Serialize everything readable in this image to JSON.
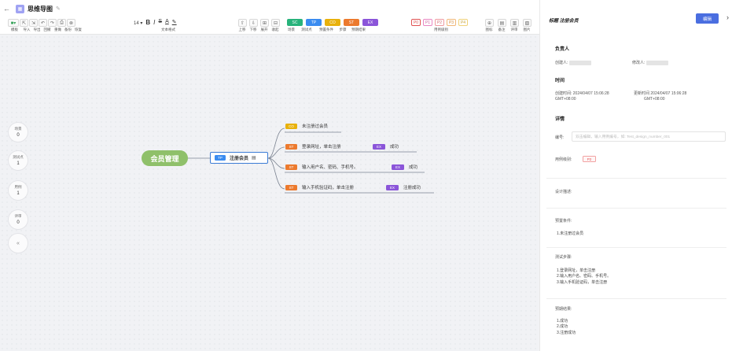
{
  "app": {
    "title": "思维导图"
  },
  "toolbar": {
    "edit_labels": [
      "模板",
      "导入",
      "导出",
      "回撤",
      "重做",
      "备份",
      "恢复"
    ],
    "font_size": "14",
    "text_format_caption": "文本格式",
    "node_labels": [
      "上移",
      "下移",
      "展开",
      "收起"
    ],
    "tags": [
      {
        "text": "SC",
        "color": "#28b37b",
        "label": "场景"
      },
      {
        "text": "TP",
        "color": "#3b8cf0",
        "label": "测试点"
      },
      {
        "text": "CO",
        "color": "#e8b10c",
        "label": "预置条件"
      },
      {
        "text": "ST",
        "color": "#ec7a2e",
        "label": "步骤"
      },
      {
        "text": "EX",
        "color": "#8b55d9",
        "label": "预期结果"
      }
    ],
    "priority_caption": "用例级别",
    "priority_tags": [
      "P0",
      "P1",
      "P2",
      "P3",
      "P4"
    ],
    "right_labels": [
      "图标",
      "备注",
      "评审",
      "图片"
    ]
  },
  "side_stats": [
    {
      "label": "场景",
      "value": "0"
    },
    {
      "label": "测试点",
      "value": "1"
    },
    {
      "label": "用例",
      "value": "1"
    },
    {
      "label": "评审",
      "value": "0"
    }
  ],
  "mindmap": {
    "root": "会员管理",
    "test_point": {
      "badge": "TP",
      "label": "注册会员"
    },
    "leaves": [
      {
        "badge": "CO",
        "text": "未注册过会员"
      },
      {
        "badge": "ST",
        "text": "登录网址，单击注册",
        "result_badge": "EX",
        "result": "成功"
      },
      {
        "badge": "ST",
        "text": "输入用户名、密码、手机号。",
        "result_badge": "EX",
        "result": "成功"
      },
      {
        "badge": "ST",
        "text": "输入手机验证码，单击注册",
        "result_badge": "EX",
        "result": "注册成功"
      }
    ]
  },
  "panel": {
    "header": "标题  注册会员",
    "edit_button": "编辑",
    "owner_title": "负责人",
    "creator_label": "创建人:",
    "modifier_label": "修改人:",
    "time_title": "时间",
    "created_label": "创建时间:",
    "created_value": "2024/04/07 15:06:28",
    "created_tz": "GMT+08:00",
    "updated_label": "更新时间",
    "updated_value": "2024/04/07 15:06:28",
    "updated_tz": "GMT+08:00",
    "detail_title": "详情",
    "number_label": "编号:",
    "number_placeholder": "双击编辑，输入用例编号，如: Test_design_number_001",
    "priority_label": "用例级别:",
    "priority_value": "P2",
    "design_label": "设计描述:",
    "precondition_label": "预置条件:",
    "precondition_value": "1.未注册过会员",
    "steps_label": "测试步骤:",
    "steps": [
      "1.登录网址，单击注册",
      "2.输入用户名、密码、手机号。",
      "3.输入手机验证码，单击注册"
    ],
    "expected_label": "预期结果:",
    "expected": [
      "1.成功",
      "2.成功",
      "3.注册成功"
    ]
  },
  "colors": {
    "accent": "#4a6ee0",
    "root": "#8fc06a",
    "tp": "#3b8cf0",
    "co": "#e8b10c",
    "st": "#ec7a2e",
    "ex": "#8b55d9"
  }
}
